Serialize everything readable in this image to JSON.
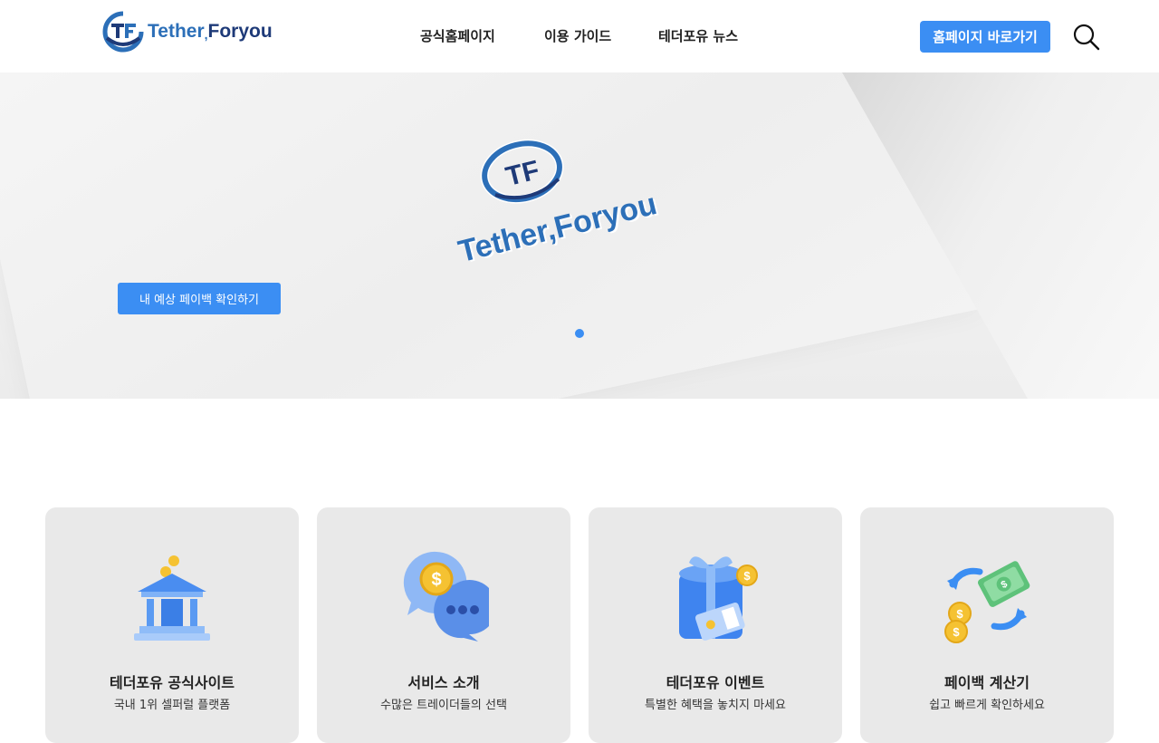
{
  "header": {
    "logo": {
      "name_part1": "Tether",
      "name_part2": "Foryou",
      "separator": ","
    },
    "nav": [
      {
        "label": "공식홈페이지"
      },
      {
        "label": "이용 가이드"
      },
      {
        "label": "테더포유 뉴스"
      }
    ],
    "cta_label": "홈페이지 바로가기",
    "search_icon": "search-icon"
  },
  "hero": {
    "logo_text": "Tether,Foryou",
    "logo_monogram": "TF",
    "button_label": "내 예상 페이백 확인하기",
    "slide_count": 1,
    "active_slide": 1
  },
  "cards": [
    {
      "title": "테더포유 공식사이트",
      "subtitle": "국내 1위 셀퍼럴 플랫폼",
      "icon": "bank-icon"
    },
    {
      "title": "서비스 소개",
      "subtitle": "수많은 트레이더들의 선택",
      "icon": "chat-coin-icon"
    },
    {
      "title": "테더포유 이벤트",
      "subtitle": "특별한 혜택을 놓치지 마세요",
      "icon": "gift-icon"
    },
    {
      "title": "페이백 계산기",
      "subtitle": "쉽고 빠르게 확인하세요",
      "icon": "exchange-icon"
    }
  ],
  "colors": {
    "accent": "#3b8ef3",
    "brand_dark": "#1e3a78",
    "brand": "#2c6fb8",
    "card_bg": "#e9e9e9"
  }
}
